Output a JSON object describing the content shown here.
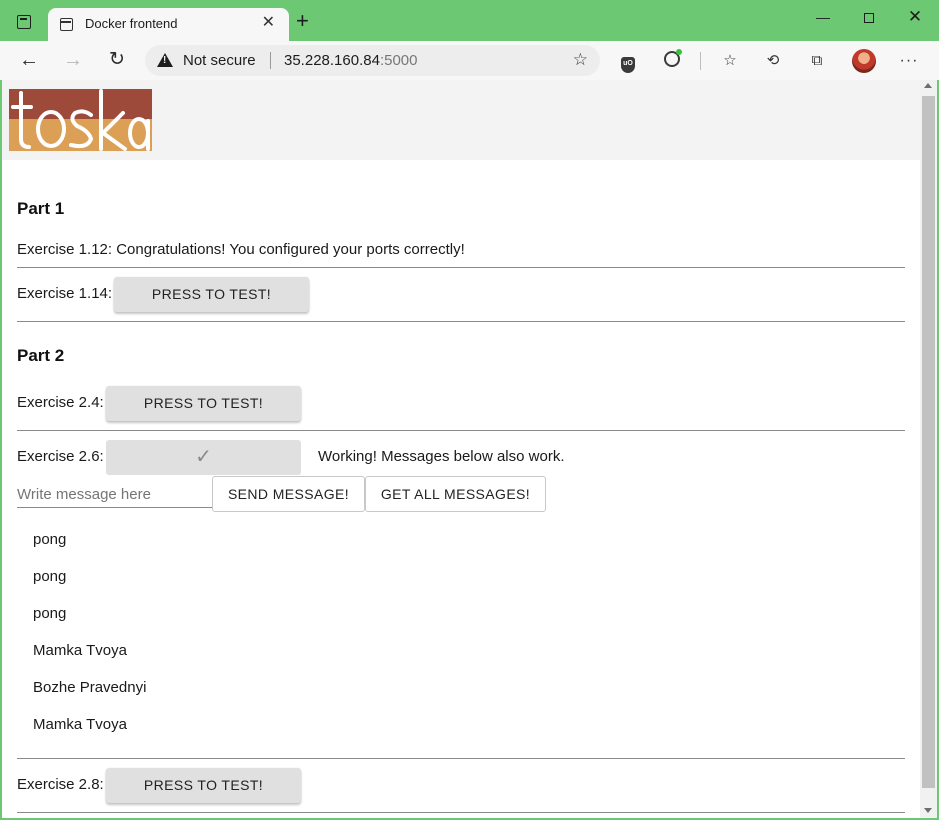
{
  "browser": {
    "tab_title": "Docker frontend",
    "tab_close": "✕",
    "new_tab": "+",
    "security_label": "Not secure",
    "url_host": "35.228.160.84",
    "url_port": ":5000"
  },
  "page": {
    "logo_text": "toska",
    "part1": {
      "heading": "Part 1",
      "ex112_text": "Exercise 1.12: Congratulations! You configured your ports correctly!",
      "ex114_label": "Exercise 1.14:",
      "ex114_button": "PRESS TO TEST!"
    },
    "part2": {
      "heading": "Part 2",
      "ex24_label": "Exercise 2.4:",
      "ex24_button": "PRESS TO TEST!",
      "ex26_label": "Exercise 2.6:",
      "ex26_status": "Working! Messages below also work.",
      "message_placeholder": "Write message here",
      "send_button": "SEND MESSAGE!",
      "get_all_button": "GET ALL MESSAGES!",
      "messages": [
        "pong",
        "pong",
        "pong",
        "Mamka Tvoya",
        "Bozhe Pravednyi",
        "Mamka Tvoya"
      ],
      "ex28_label": "Exercise 2.8:",
      "ex28_button": "PRESS TO TEST!"
    }
  },
  "colors": {
    "window_frame": "#6cc872",
    "logo_dark": "#9e4a3a",
    "logo_light": "#dba055",
    "button_gray": "#e0e0e0"
  }
}
